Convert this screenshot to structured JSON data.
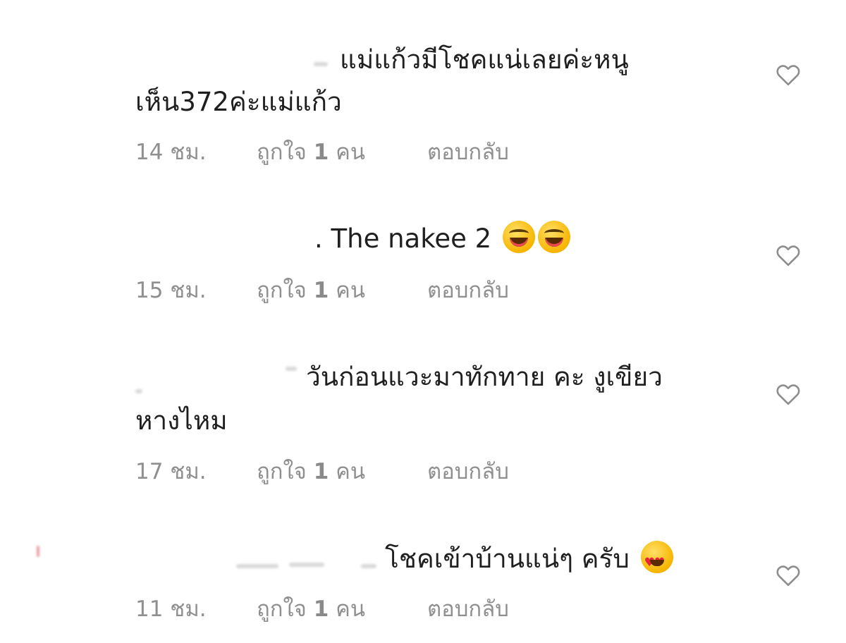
{
  "comments": [
    {
      "line1": "แม่แก้วมีโชคแน่เลยค่ะหนู",
      "line2": "เห็น372ค่ะแม่แก้ว",
      "time": "14 ชม.",
      "likes_prefix": "ถูกใจ ",
      "likes_count": "1",
      "likes_suffix": " คน",
      "reply": "ตอบกลับ",
      "emoji": []
    },
    {
      "line1": ". The nakee 2",
      "time": "15 ชม.",
      "likes_prefix": "ถูกใจ ",
      "likes_count": "1",
      "likes_suffix": " คน",
      "reply": "ตอบกลับ",
      "emoji": [
        "face-with-tears-of-joy-emoji",
        "face-with-tears-of-joy-emoji"
      ]
    },
    {
      "line1": "วันก่อนแวะมาทักทาย คะ งูเขียว",
      "line2": "หางไหม",
      "time": "17 ชม.",
      "likes_prefix": "ถูกใจ ",
      "likes_count": "1",
      "likes_suffix": " คน",
      "reply": "ตอบกลับ",
      "emoji": []
    },
    {
      "line1": "โชคเข้าบ้านแน่ๆ ครับ",
      "time": "11 ชม.",
      "likes_prefix": "ถูกใจ ",
      "likes_count": "1",
      "likes_suffix": " คน",
      "reply": "ตอบกลับ",
      "emoji": [
        "smiling-face-with-heart-eyes-emoji"
      ]
    }
  ],
  "icons": {
    "like": "heart-outline-icon"
  },
  "colors": {
    "text": "#1f1f1f",
    "meta": "#8f8f8f",
    "icon": "#8e8e8e"
  }
}
